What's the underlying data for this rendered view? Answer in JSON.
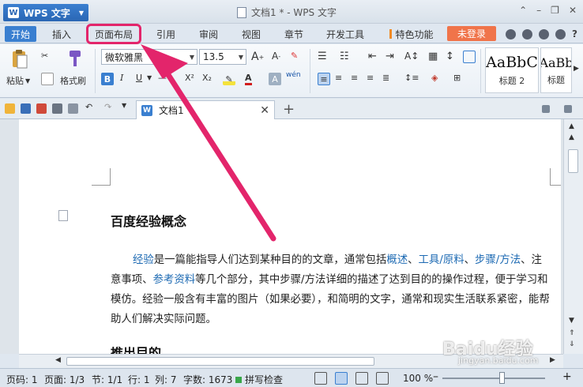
{
  "app": {
    "name": "WPS 文字",
    "logo": "W",
    "window_title": "文档1 * - WPS 文字"
  },
  "menu": {
    "tabs": [
      "开始",
      "插入",
      "页面布局",
      "引用",
      "审阅",
      "视图",
      "章节",
      "开发工具",
      "特色功能"
    ],
    "login": "未登录",
    "help": "?"
  },
  "ribbon": {
    "paste": "粘贴",
    "format_painter": "格式刷",
    "font_name": "微软雅黑",
    "font_size": "13.5",
    "styles": [
      {
        "sample": "AaBbC",
        "name": "标题 2"
      },
      {
        "sample": "AaBb",
        "name": "标题"
      }
    ]
  },
  "document_tab": {
    "name": "文档1",
    "icon": "W"
  },
  "document": {
    "heading": "百度经验概念",
    "paragraph": [
      {
        "t": "经验",
        "link": true
      },
      {
        "t": "是一篇能指导人们达到某种目的的文章，通常包括",
        "link": false
      },
      {
        "t": "概述",
        "link": true
      },
      {
        "t": "、",
        "link": false
      },
      {
        "t": "工具/原料",
        "link": true
      },
      {
        "t": "、",
        "link": false
      },
      {
        "t": "步骤/方法",
        "link": true
      },
      {
        "t": "、注意事项、",
        "link": false
      },
      {
        "t": "参考资料",
        "link": true
      },
      {
        "t": "等几个部分，其中步骤/方法详细的描述了达到目的的操作过程，便于学习和模仿。经验一般含有丰富的图片（如果必要），和简明的文字，通常和现实生活联系紧密，能帮助人们解决实际问题。",
        "link": false
      }
    ],
    "heading2": "推出目的"
  },
  "status": {
    "page": "页码: 1",
    "pages": "页面: 1/3",
    "section": "节: 1/1",
    "row": "行: 1",
    "col": "列: 7",
    "words": "字数: 1673",
    "spell": "拼写检查",
    "zoom": "100 %"
  },
  "watermark": {
    "main": "Baidu经验",
    "sub": "jingyan.baidu.com"
  },
  "colors": {
    "accent": "#3a7fd0",
    "highlight": "#e3256b",
    "login": "#f0744a",
    "link": "#1d6ab3"
  }
}
